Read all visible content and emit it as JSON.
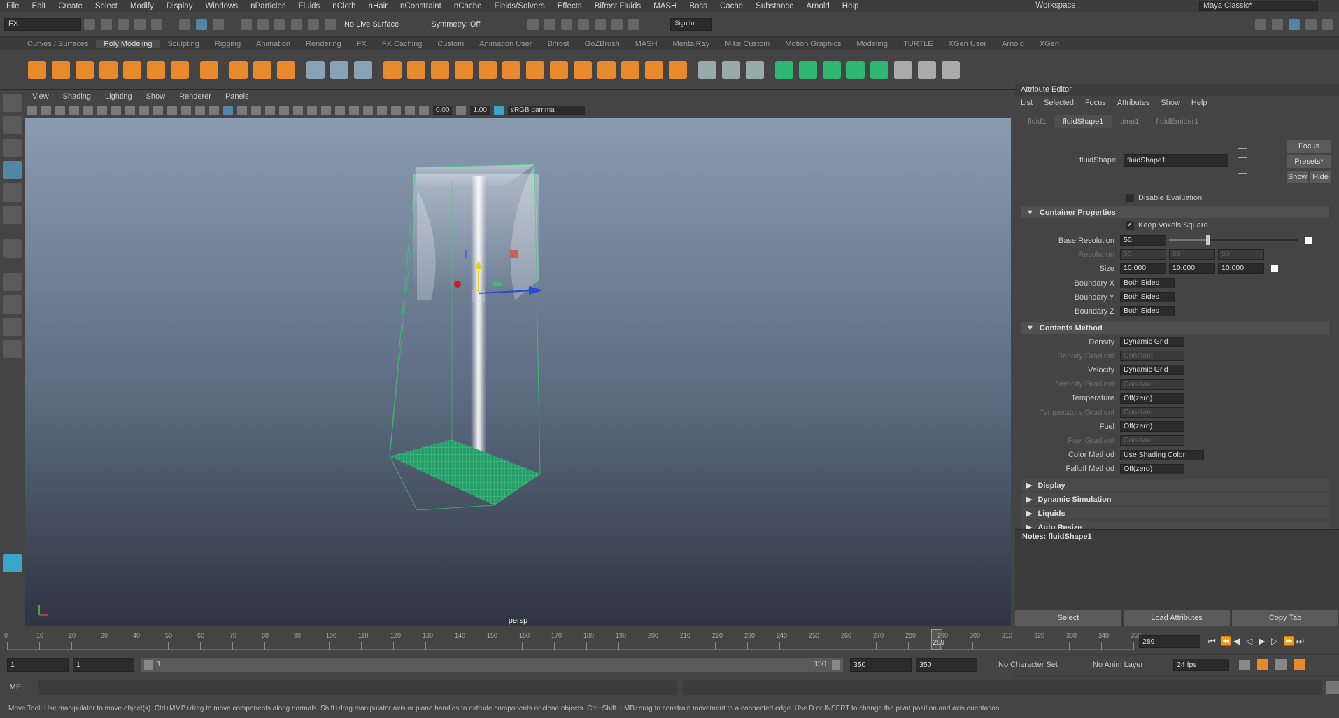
{
  "menubar": {
    "items": [
      "File",
      "Edit",
      "Create",
      "Select",
      "Modify",
      "Display",
      "Windows",
      "nParticles",
      "Fluids",
      "nCloth",
      "nHair",
      "nConstraint",
      "nCache",
      "Fields/Solvers",
      "Effects",
      "Bifrost Fluids",
      "MASH",
      "Boss",
      "Cache",
      "Substance",
      "Arnold",
      "Help"
    ],
    "workspace_label": "Workspace :",
    "workspace_value": "Maya Classic*"
  },
  "statusline": {
    "menuset": "FX",
    "live_surface": "No Live Surface",
    "symmetry": "Symmetry: Off",
    "sign_in": "Sign In"
  },
  "shelf": {
    "tabs": [
      "Curves / Surfaces",
      "Poly Modeling",
      "Sculpting",
      "Rigging",
      "Animation",
      "Rendering",
      "FX",
      "FX Caching",
      "Custom",
      "Animation User",
      "Bifrost",
      "GoZBrush",
      "MASH",
      "MentalRay",
      "Mike Custom",
      "Motion Graphics",
      "Modeling",
      "TURTLE",
      "XGen User",
      "Arnold",
      "XGen"
    ],
    "active_tab": "Poly Modeling"
  },
  "viewport": {
    "menus": [
      "View",
      "Shading",
      "Lighting",
      "Show",
      "Renderer",
      "Panels"
    ],
    "near_value": "0.00",
    "far_value": "1.00",
    "colorspace": "sRGB gamma",
    "camera_label": "persp"
  },
  "attribute_editor": {
    "title": "Attribute Editor",
    "menus": [
      "List",
      "Selected",
      "Focus",
      "Attributes",
      "Show",
      "Help"
    ],
    "tabs": [
      "fluid1",
      "fluidShape1",
      "time1",
      "fluidEmitter1"
    ],
    "active_tab": "fluidShape1",
    "node_label": "fluidShape:",
    "node_name": "fluidShape1",
    "focus_btn": "Focus",
    "presets_btn": "Presets*",
    "show_btn": "Show",
    "hide_btn": "Hide",
    "disable_eval": "Disable Evaluation",
    "container_section": "Container Properties",
    "keep_voxels": "Keep Voxels Square",
    "base_res_label": "Base Resolution",
    "base_res_value": "50",
    "base_res_fraction": 0.3,
    "resolution_label": "Resolution",
    "resolution_values": [
      "50",
      "50",
      "50"
    ],
    "size_label": "Size",
    "size_values": [
      "10.000",
      "10.000",
      "10.000"
    ],
    "boundary": [
      {
        "label": "Boundary X",
        "value": "Both Sides"
      },
      {
        "label": "Boundary Y",
        "value": "Both Sides"
      },
      {
        "label": "Boundary Z",
        "value": "Both Sides"
      }
    ],
    "contents_section": "Contents Method",
    "contents": [
      {
        "label": "Density",
        "value": "Dynamic Grid",
        "dim": false
      },
      {
        "label": "Density Gradient",
        "value": "Constant",
        "dim": true
      },
      {
        "label": "Velocity",
        "value": "Dynamic Grid",
        "dim": false
      },
      {
        "label": "Velocity Gradient",
        "value": "Constant",
        "dim": true
      },
      {
        "label": "Temperature",
        "value": "Off(zero)",
        "dim": false
      },
      {
        "label": "Temperature Gradient",
        "value": "Constant",
        "dim": true
      },
      {
        "label": "Fuel",
        "value": "Off(zero)",
        "dim": false
      },
      {
        "label": "Fuel Gradient",
        "value": "Constant",
        "dim": true
      },
      {
        "label": "Color Method",
        "value": "Use Shading Color",
        "dim": false
      },
      {
        "label": "Falloff Method",
        "value": "Off(zero)",
        "dim": false
      }
    ],
    "collapsed_sections": [
      "Display",
      "Dynamic Simulation",
      "Liquids",
      "Auto Resize"
    ],
    "notes_label": "Notes: fluidShape1",
    "select_btn": "Select",
    "load_btn": "Load Attributes",
    "copy_btn": "Copy Tab"
  },
  "timeslider": {
    "ticks": [
      "0",
      "10",
      "20",
      "30",
      "40",
      "50",
      "60",
      "70",
      "80",
      "90",
      "100",
      "110",
      "120",
      "130",
      "140",
      "150",
      "160",
      "170",
      "180",
      "190",
      "200",
      "210",
      "220",
      "230",
      "240",
      "250",
      "260",
      "270",
      "280",
      "290",
      "300",
      "310",
      "320",
      "330",
      "340",
      "350"
    ],
    "current_frame": "289",
    "playhead_label": "289"
  },
  "rangeslider": {
    "start": "1",
    "playback_start": "1",
    "range_start": "1",
    "range_end": "350",
    "playback_end": "350",
    "end": "350",
    "character_set": "No Character Set",
    "anim_layer": "No Anim Layer",
    "fps": "24 fps"
  },
  "cmdline": {
    "lang": "MEL"
  },
  "helpline": "Move Tool: Use manipulator to move object(s). Ctrl+MMB+drag to move components along normals. Shift+drag manipulator axis or plane handles to extrude components or clone objects. Ctrl+Shift+LMB+drag to constrain movement to a connected edge. Use D or INSERT to change the pivot position and axis orientation.",
  "colors": {
    "accent": "#5285a6",
    "grid": "#2fb87a",
    "bbox": "#36d46e"
  }
}
